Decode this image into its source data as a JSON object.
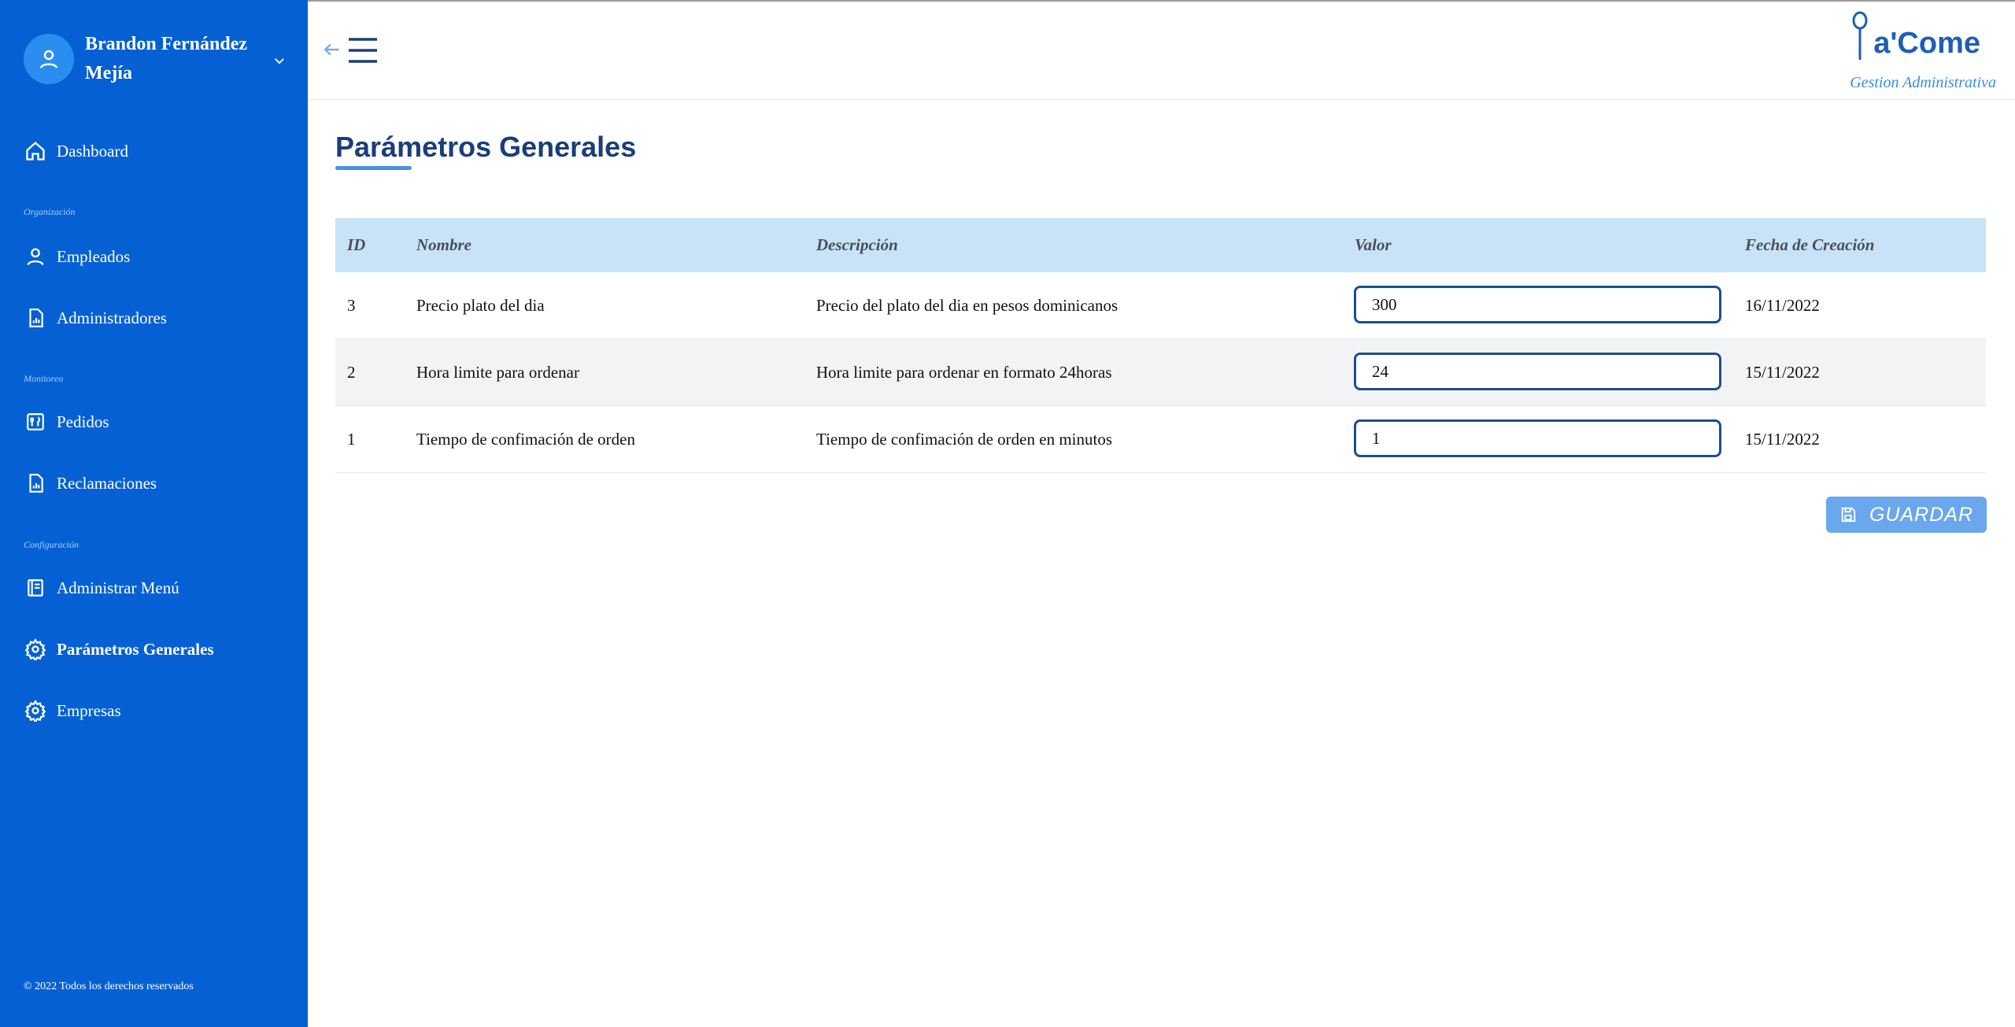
{
  "user": {
    "name": "Brandon Fernández Mejía"
  },
  "sidebar": {
    "items": [
      {
        "label": "Dashboard",
        "icon": "home-icon"
      },
      {
        "label": "Empleados",
        "icon": "user-icon"
      },
      {
        "label": "Administradores",
        "icon": "report-icon"
      },
      {
        "label": "Pedidos",
        "icon": "utensils-icon"
      },
      {
        "label": "Reclamaciones",
        "icon": "report-icon"
      },
      {
        "label": "Administrar Menú",
        "icon": "menu-book-icon"
      },
      {
        "label": "Parámetros Generales",
        "icon": "gear-icon",
        "active": true
      },
      {
        "label": "Empresas",
        "icon": "gear-icon"
      }
    ],
    "sections": [
      "Organización",
      "Monitoreo",
      "Configuración"
    ],
    "copyright": "© 2022 Todos los derechos reservados"
  },
  "header": {
    "logo_text": "a'Come",
    "logo_subtitle": "Gestion Administrativa"
  },
  "main": {
    "title": "Parámetros Generales",
    "columns": [
      "ID",
      "Nombre",
      "Descripción",
      "Valor",
      "Fecha de Creación"
    ],
    "rows": [
      {
        "id": "3",
        "nombre": "Precio plato del dia",
        "descripcion": "Precio del plato del dia en pesos dominicanos",
        "valor": "300",
        "fecha": "16/11/2022"
      },
      {
        "id": "2",
        "nombre": "Hora limite para ordenar",
        "descripcion": "Hora limite para ordenar en formato 24horas",
        "valor": "24",
        "fecha": "15/11/2022"
      },
      {
        "id": "1",
        "nombre": "Tiempo de confimación de orden",
        "descripcion": "Tiempo de confimación de orden en minutos",
        "valor": "1",
        "fecha": "15/11/2022"
      }
    ],
    "save_label": "GUARDAR"
  },
  "colors": {
    "sidebar_bg": "#0561d3",
    "table_header_bg": "#c8e3f8",
    "title": "#1c3d7a",
    "button_bg": "#6aa7ec"
  }
}
